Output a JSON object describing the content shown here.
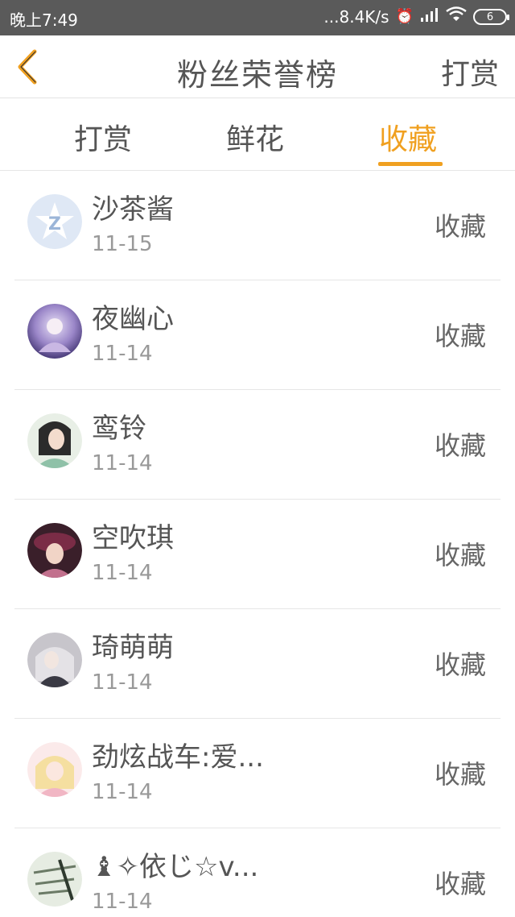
{
  "status_bar": {
    "time": "晚上7:49",
    "network_speed": "...8.4K/s",
    "alarm_icon": "alarm-icon",
    "signal_icon": "signal-icon",
    "wifi_icon": "wifi-icon",
    "battery_level": "6"
  },
  "nav": {
    "back_icon": "back-chevron-icon",
    "title": "粉丝荣誉榜",
    "action_label": "打赏"
  },
  "tabs": [
    {
      "label": "打赏",
      "active": false
    },
    {
      "label": "鲜花",
      "active": false
    },
    {
      "label": "收藏",
      "active": true
    }
  ],
  "accent_color": "#f0a020",
  "list": [
    {
      "name": "沙茶酱",
      "date": "11-15",
      "action": "收藏",
      "avatar": "default-avatar"
    },
    {
      "name": "夜幽心",
      "date": "11-14",
      "action": "收藏",
      "avatar": "user-avatar"
    },
    {
      "name": "鸾铃",
      "date": "11-14",
      "action": "收藏",
      "avatar": "user-avatar"
    },
    {
      "name": "空吹琪",
      "date": "11-14",
      "action": "收藏",
      "avatar": "user-avatar"
    },
    {
      "name": "琦萌萌",
      "date": "11-14",
      "action": "收藏",
      "avatar": "user-avatar"
    },
    {
      "name": "劲炫战车:爱...",
      "date": "11-14",
      "action": "收藏",
      "avatar": "user-avatar"
    },
    {
      "name": "♝✧依じ☆v...",
      "date": "11-14",
      "action": "收藏",
      "avatar": "user-avatar"
    }
  ]
}
